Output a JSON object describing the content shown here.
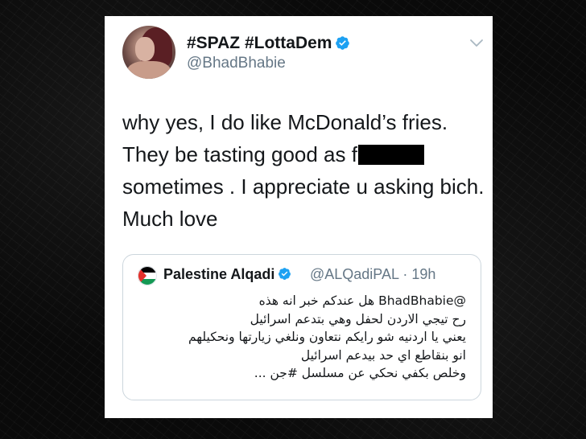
{
  "tweet": {
    "display_name": "#SPAZ #LottaDem",
    "handle": "@BhadBhabie",
    "text_lines": [
      "why yes, I do like McDonald’s fries.",
      "They be tasting good as f",
      "sometimes . I appreciate u asking bich.",
      "Much love"
    ]
  },
  "quoted_tweet": {
    "display_name": "Palestine Alqadi",
    "handle_time": "@ALQadiPAL · 19h",
    "text_lines": [
      "@BhadBhabie هل عندكم خبر انه هذه",
      "رح تيجي الاردن لحفل وهي بتدعم اسرائيل",
      "يعني يا اردنيه شو رايكم نتعاون ونلغي زيارتها ونحكيلهم",
      "انو بنقاطع اي حد بيدعم اسرائيل",
      "وخلص بكفي نحكي عن مسلسل #جن ..."
    ]
  },
  "icons": {
    "verified": "verified-badge-icon",
    "menu": "chevron-down-icon",
    "flag": "palestine-flag-icon"
  },
  "colors": {
    "verified_blue": "#1da1f2",
    "secondary_text": "#657786",
    "primary_text": "#14171a",
    "border": "#ccd6dd"
  }
}
